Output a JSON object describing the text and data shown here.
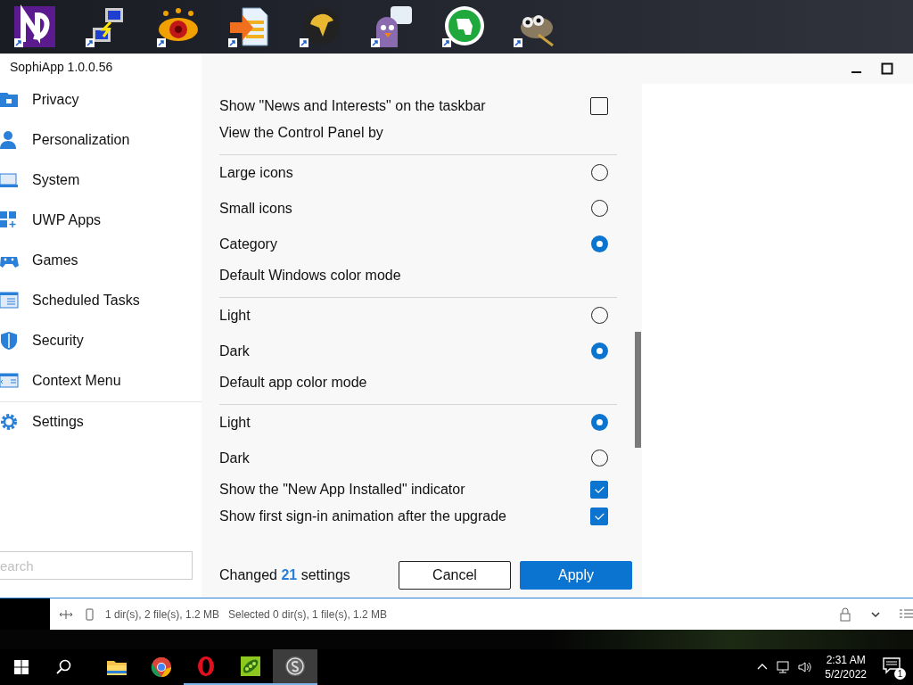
{
  "window": {
    "title": "SophiApp 1.0.0.56"
  },
  "sidebar": {
    "items": [
      {
        "label": "Privacy",
        "selected": false
      },
      {
        "label": "Personalization",
        "selected": false
      },
      {
        "label": "System",
        "selected": false
      },
      {
        "label": "UWP Apps",
        "selected": false
      },
      {
        "label": "Games",
        "selected": false
      },
      {
        "label": "Scheduled Tasks",
        "selected": false
      },
      {
        "label": "Security",
        "selected": false
      },
      {
        "label": "Context Menu",
        "selected": false
      },
      {
        "label": "Settings",
        "selected": false
      }
    ],
    "search": {
      "placeholder": "earch"
    }
  },
  "settings": [
    {
      "kind": "checkbox",
      "label": "Show \"News and Interests\" on the taskbar",
      "checked": false
    },
    {
      "kind": "header",
      "label": "View the Control Panel by"
    },
    {
      "kind": "radio",
      "label": "Large icons",
      "selected": false
    },
    {
      "kind": "radio",
      "label": "Small icons",
      "selected": false
    },
    {
      "kind": "radio",
      "label": "Category",
      "selected": true
    },
    {
      "kind": "header",
      "label": "Default Windows color mode"
    },
    {
      "kind": "radio",
      "label": "Light",
      "selected": false
    },
    {
      "kind": "radio",
      "label": "Dark",
      "selected": true
    },
    {
      "kind": "header",
      "label": "Default app color mode"
    },
    {
      "kind": "radio",
      "label": "Light",
      "selected": true
    },
    {
      "kind": "radio",
      "label": "Dark",
      "selected": false
    },
    {
      "kind": "checkbox",
      "label": "Show the \"New App Installed\" indicator",
      "checked": true
    },
    {
      "kind": "checkbox",
      "label": "Show first sign-in animation after the upgrade",
      "checked": true
    }
  ],
  "footer": {
    "summary": "Changed **21** settings",
    "buttons": [
      {
        "label": "Cancel",
        "kind": "secondary"
      },
      {
        "label": "Apply",
        "kind": "primary"
      }
    ]
  },
  "status_bar": {
    "items": [
      "1 dir(s), 2 file(s), 1.2 MB",
      "Selected 0 dir(s), 1 file(s), 1.2 MB"
    ]
  },
  "taskbar": {
    "apps": [
      {
        "running": false,
        "active": false
      },
      {
        "running": false,
        "active": false
      },
      {
        "running": true,
        "active": false
      },
      {
        "running": true,
        "active": false
      },
      {
        "running": true,
        "active": true
      }
    ],
    "time": "2:31 AM",
    "date": "5/2/2022",
    "notification_count": "1"
  }
}
